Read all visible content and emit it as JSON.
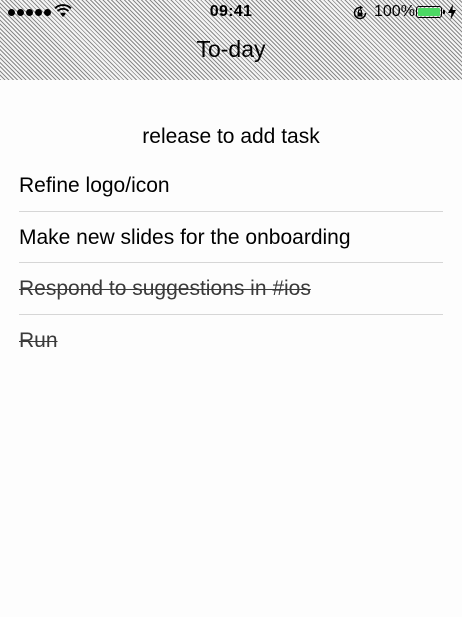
{
  "status_bar": {
    "time": "09:41",
    "battery_percent": "100%",
    "battery_level": 1.0,
    "battery_color": "#4cd964",
    "signal_bars": 5,
    "icons": [
      "signal-dots-icon",
      "wifi-icon",
      "rotation-lock-icon",
      "battery-icon",
      "charging-bolt-icon"
    ]
  },
  "header": {
    "title": "To-day"
  },
  "pull_hint": "release to add task",
  "tasks": [
    {
      "label": "Refine logo/icon",
      "completed": false
    },
    {
      "label": "Make new slides for the onboarding",
      "completed": false
    },
    {
      "label": "Respond to suggestions in #ios",
      "completed": true
    },
    {
      "label": "Run",
      "completed": true
    }
  ]
}
